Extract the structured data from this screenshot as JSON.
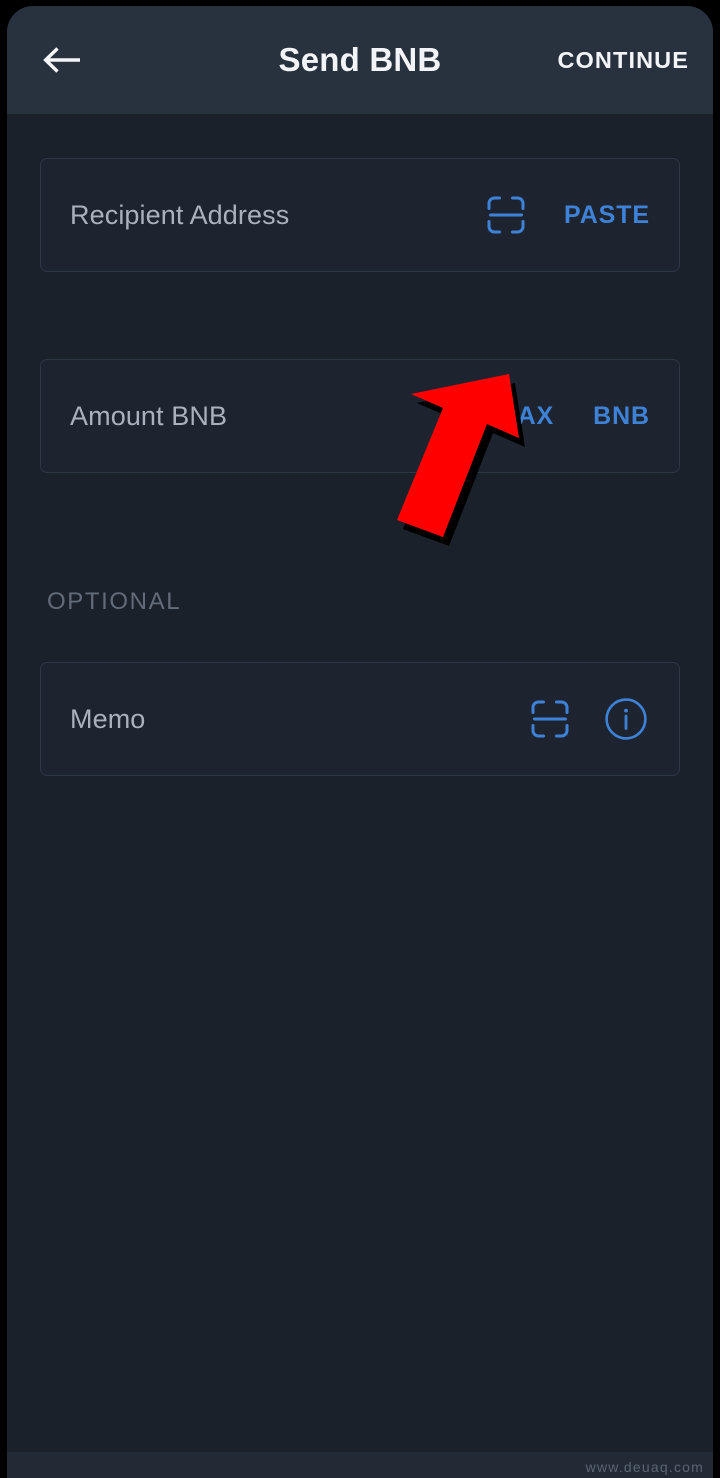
{
  "app": {
    "screen_title": "Send BNB",
    "background_color": "#1b212b",
    "appbar_color": "#28323f",
    "accent_color": "#3e82d8",
    "label_color": "#a9b1bd"
  },
  "appbar": {
    "back_icon": "arrow-left-icon",
    "title": "Send BNB",
    "continue_label": "CONTINUE"
  },
  "fields": {
    "recipient": {
      "label": "Recipient Address",
      "value": "",
      "placeholder": "Recipient Address",
      "scan_icon": "scan-qr-icon",
      "paste_label": "PASTE"
    },
    "amount": {
      "label": "Amount BNB",
      "value": "",
      "placeholder": "Amount BNB",
      "max_label": "MAX",
      "currency_label": "BNB"
    },
    "memo": {
      "label": "Memo",
      "value": "",
      "placeholder": "Memo",
      "scan_icon": "scan-qr-icon",
      "info_icon": "info-circle-icon"
    }
  },
  "sections": {
    "optional_label": "OPTIONAL"
  },
  "annotation": {
    "arrow": "red-arrow-up-right",
    "arrow_color": "#ff0000",
    "shadow_color": "#000000"
  },
  "watermark": {
    "text": "www.deuaq.com"
  }
}
